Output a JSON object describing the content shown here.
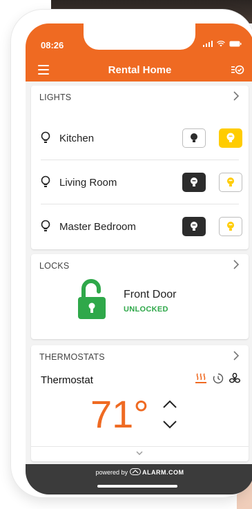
{
  "status_bar": {
    "time": "08:26"
  },
  "header": {
    "title": "Rental Home"
  },
  "lights": {
    "section_title": "LIGHTS",
    "items": [
      {
        "name": "Kitchen",
        "state": "on"
      },
      {
        "name": "Living Room",
        "state": "off"
      },
      {
        "name": "Master Bedroom",
        "state": "off"
      }
    ]
  },
  "locks": {
    "section_title": "LOCKS",
    "device": "Front Door",
    "status": "UNLOCKED",
    "status_color": "#2fa84a"
  },
  "thermostats": {
    "section_title": "THERMOSTATS",
    "name": "Thermostat",
    "temperature": "71°",
    "modes": [
      "heat-icon",
      "schedule-icon",
      "fan-icon"
    ]
  },
  "footer": {
    "powered_prefix": "powered by",
    "brand": "ALARM.COM"
  },
  "colors": {
    "accent": "#ef6a22",
    "on_yellow": "#ffcc00",
    "dark_button": "#2c2c2c"
  }
}
